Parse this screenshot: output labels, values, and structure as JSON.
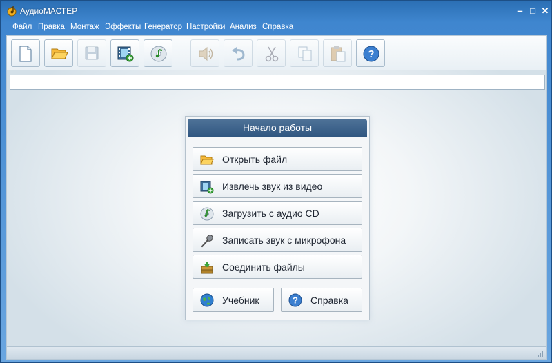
{
  "window": {
    "title": "АудиоМАСТЕР"
  },
  "window_controls": {
    "minimize": "–",
    "maximize": "□",
    "close": "✕"
  },
  "menu": [
    "Файл",
    "Правка",
    "Монтаж",
    "Эффекты",
    "Генератор",
    "Настройки",
    "Анализ",
    "Справка"
  ],
  "toolbar": {
    "buttons": [
      {
        "icon": "new-file-icon",
        "enabled": true
      },
      {
        "icon": "open-folder-icon",
        "enabled": true
      },
      {
        "icon": "save-icon",
        "enabled": false
      },
      {
        "icon": "film-add-icon",
        "enabled": true
      },
      {
        "icon": "cd-music-icon",
        "enabled": true
      },
      {
        "icon": "speaker-icon",
        "enabled": false
      },
      {
        "icon": "undo-icon",
        "enabled": false
      },
      {
        "icon": "cut-icon",
        "enabled": false
      },
      {
        "icon": "copy-icon",
        "enabled": false
      },
      {
        "icon": "paste-icon",
        "enabled": false
      },
      {
        "icon": "help-icon",
        "enabled": true
      }
    ]
  },
  "address_bar": {
    "value": ""
  },
  "start_panel": {
    "title": "Начало работы",
    "actions": [
      {
        "label": "Открыть файл",
        "icon": "open-folder-icon"
      },
      {
        "label": "Извлечь звук из видео",
        "icon": "film-add-icon"
      },
      {
        "label": "Загрузить с аудио CD",
        "icon": "cd-music-icon"
      },
      {
        "label": "Записать звук с микрофона",
        "icon": "microphone-icon"
      },
      {
        "label": "Соединить файлы",
        "icon": "join-files-icon"
      }
    ],
    "tutorial_label": "Учебник",
    "help_label": "Справка"
  },
  "colors": {
    "titlebar": "#3f86cf",
    "panel_header": "#3a6089",
    "accent": "#2b6fb4"
  }
}
